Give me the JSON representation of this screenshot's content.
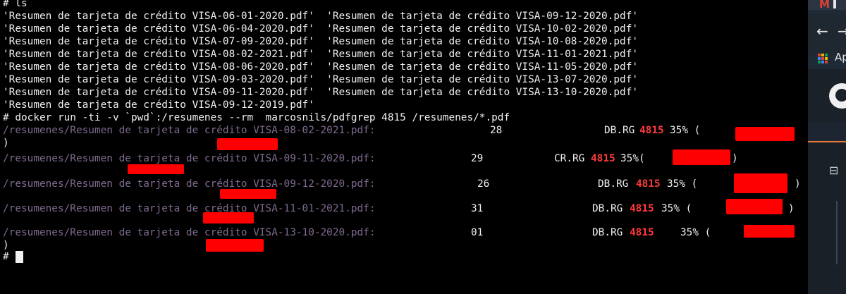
{
  "terminal": {
    "ls_lines": [
      "# ls",
      "'Resumen de tarjeta de crédito VISA-06-01-2020.pdf'  'Resumen de tarjeta de crédito VISA-09-12-2020.pdf'",
      "'Resumen de tarjeta de crédito VISA-06-04-2020.pdf'  'Resumen de tarjeta de crédito VISA-10-02-2020.pdf'",
      "'Resumen de tarjeta de crédito VISA-07-09-2020.pdf'  'Resumen de tarjeta de crédito VISA-10-08-2020.pdf'",
      "'Resumen de tarjeta de crédito VISA-08-02-2021.pdf'  'Resumen de tarjeta de crédito VISA-11-01-2021.pdf'",
      "'Resumen de tarjeta de crédito VISA-08-06-2020.pdf'  'Resumen de tarjeta de crédito VISA-11-05-2020.pdf'",
      "'Resumen de tarjeta de crédito VISA-09-03-2020.pdf'  'Resumen de tarjeta de crédito VISA-13-07-2020.pdf'",
      "'Resumen de tarjeta de crédito VISA-09-11-2020.pdf'  'Resumen de tarjeta de crédito VISA-13-10-2020.pdf'",
      "'Resumen de tarjeta de crédito VISA-09-12-2019.pdf'",
      "# docker run -ti -v `pwd`:/resumenes --rm  marcosnils/pdfgrep 4815 /resumenes/*.pdf"
    ],
    "results": [
      {
        "path": "/resumenes/Resumen de tarjeta de crédito VISA-08-02-2021.pdf:",
        "day": "28",
        "code": "DB.RG",
        "match": "4815",
        "pct": "35% (",
        "close": ")"
      },
      {
        "path": "/resumenes/Resumen de tarjeta de crédito VISA-09-11-2020.pdf:",
        "day": "29",
        "code": "CR.RG",
        "match": "4815",
        "pct": "35%(",
        "close": ")"
      },
      {
        "path": "/resumenes/Resumen de tarjeta de crédito VISA-09-12-2020.pdf:",
        "day": "26",
        "code": "DB.RG",
        "match": "4815",
        "pct": "35% (",
        "close": ")"
      },
      {
        "path": "/resumenes/Resumen de tarjeta de crédito VISA-11-01-2021.pdf:",
        "day": "31",
        "code": "DB.RG",
        "match": "4815",
        "pct": "35% (",
        "close": ")"
      },
      {
        "path": "/resumenes/Resumen de tarjeta de crédito VISA-13-10-2020.pdf:",
        "day": "01",
        "code": "DB.RG",
        "match": "4815",
        "pct": "35% (",
        "close": ")"
      }
    ],
    "prompt": "#"
  },
  "sidebar": {
    "gmail_icon": "M",
    "back_icon": "←",
    "forward_icon": "→",
    "apps_label": "Ap",
    "bookmark_icon": "⊟"
  },
  "colors": {
    "background": "#000000",
    "text": "#f0f0f0",
    "path": "#7e6b8f",
    "match": "#ff3b3b",
    "redaction": "#ff0000"
  }
}
